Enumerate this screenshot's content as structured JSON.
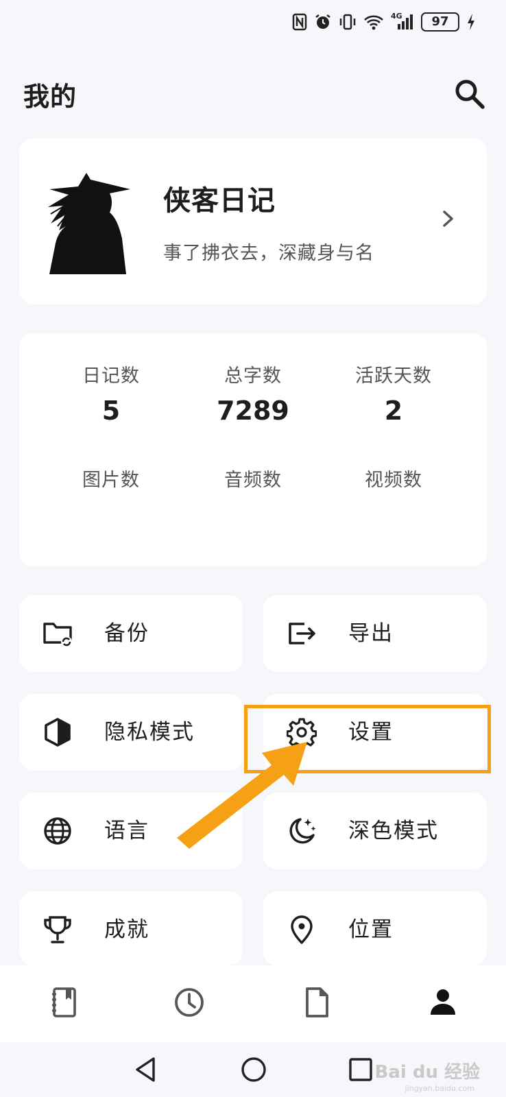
{
  "status_bar": {
    "battery": "97",
    "network": "4G",
    "icons": [
      "nfc-icon",
      "alarm-icon",
      "vibrate-icon",
      "wifi-icon",
      "signal-icon",
      "battery-icon",
      "charging-icon"
    ]
  },
  "header": {
    "title": "我的",
    "search_icon": "search-icon"
  },
  "profile": {
    "name": "侠客日记",
    "motto": "事了拂衣去，深藏身与名",
    "chevron_icon": "chevron-right-icon"
  },
  "stats": [
    {
      "label": "日记数",
      "value": "5"
    },
    {
      "label": "总字数",
      "value": "7289"
    },
    {
      "label": "活跃天数",
      "value": "2"
    },
    {
      "label": "图片数",
      "value": ""
    },
    {
      "label": "音频数",
      "value": ""
    },
    {
      "label": "视频数",
      "value": ""
    }
  ],
  "menu": [
    {
      "label": "备份",
      "icon": "folder-sync-icon"
    },
    {
      "label": "导出",
      "icon": "export-icon"
    },
    {
      "label": "隐私模式",
      "icon": "privacy-shield-icon"
    },
    {
      "label": "设置",
      "icon": "gear-icon"
    },
    {
      "label": "语言",
      "icon": "globe-icon"
    },
    {
      "label": "深色模式",
      "icon": "moon-stars-icon"
    },
    {
      "label": "成就",
      "icon": "trophy-icon"
    },
    {
      "label": "位置",
      "icon": "location-pin-icon"
    }
  ],
  "bottom_nav": [
    "diary-book-icon",
    "history-clock-icon",
    "document-icon",
    "person-icon"
  ],
  "system_nav": [
    "back-icon",
    "home-icon",
    "recents-icon"
  ],
  "annotation": {
    "color": "#f5a015"
  },
  "watermark": {
    "text": "Bai du 经验",
    "sub": "jingyan.baidu.com"
  }
}
